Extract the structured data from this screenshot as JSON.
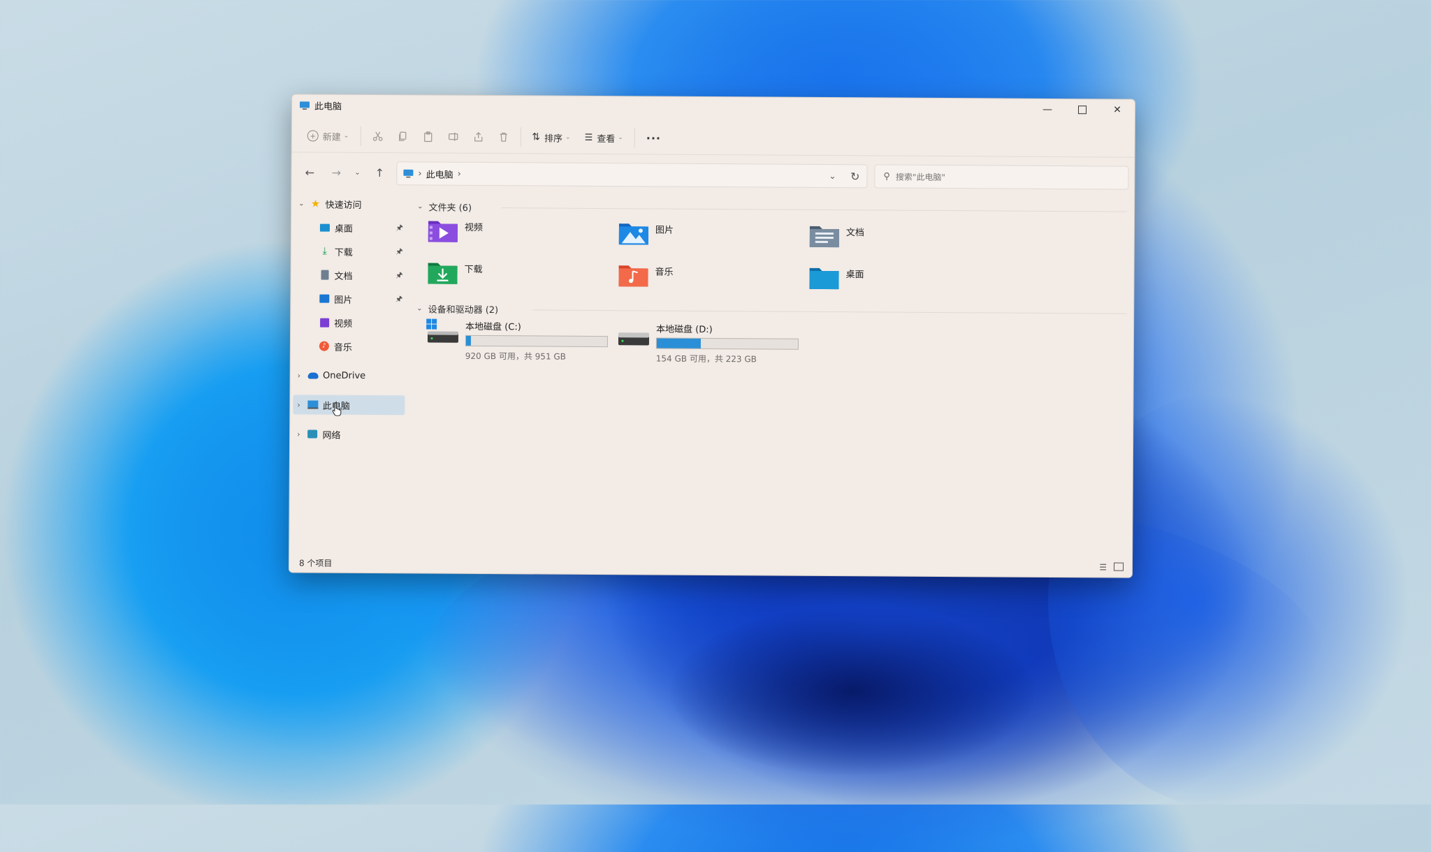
{
  "window": {
    "title": "此电脑"
  },
  "toolbar": {
    "new_label": "新建",
    "sort_label": "排序",
    "view_label": "查看",
    "more_label": "···"
  },
  "address": {
    "path": [
      "此电脑"
    ],
    "separator": "›"
  },
  "search": {
    "placeholder": "搜索\"此电脑\""
  },
  "sidebar": {
    "quick_access": "快速访问",
    "quick_items": [
      {
        "label": "桌面"
      },
      {
        "label": "下载"
      },
      {
        "label": "文档"
      },
      {
        "label": "图片"
      },
      {
        "label": "视频"
      },
      {
        "label": "音乐"
      }
    ],
    "onedrive": "OneDrive",
    "this_pc": "此电脑",
    "network": "网络"
  },
  "content": {
    "folders_header": "文件夹 (6)",
    "folders": [
      {
        "label": "视频",
        "icon": "video-folder-icon",
        "color": "#7b3fd4"
      },
      {
        "label": "图片",
        "icon": "pictures-folder-icon",
        "color": "#1976d2"
      },
      {
        "label": "文档",
        "icon": "documents-folder-icon",
        "color": "#5a7087"
      },
      {
        "label": "下载",
        "icon": "downloads-folder-icon",
        "color": "#1e9e55"
      },
      {
        "label": "音乐",
        "icon": "music-folder-icon",
        "color": "#f05a3a"
      },
      {
        "label": "桌面",
        "icon": "desktop-folder-icon",
        "color": "#1b8fd0"
      }
    ],
    "drives_header": "设备和驱动器 (2)",
    "drives": [
      {
        "name": "本地磁盘 (C:)",
        "info": "920 GB 可用，共 951 GB",
        "used_fraction": 0.033
      },
      {
        "name": "本地磁盘 (D:)",
        "info": "154 GB 可用，共 223 GB",
        "used_fraction": 0.31
      }
    ]
  },
  "status": {
    "count": "8 个项目"
  },
  "colors": {
    "accent": "#2a8fd6",
    "window_bg": "#f2ebe6",
    "selected": "#cfdde8"
  }
}
